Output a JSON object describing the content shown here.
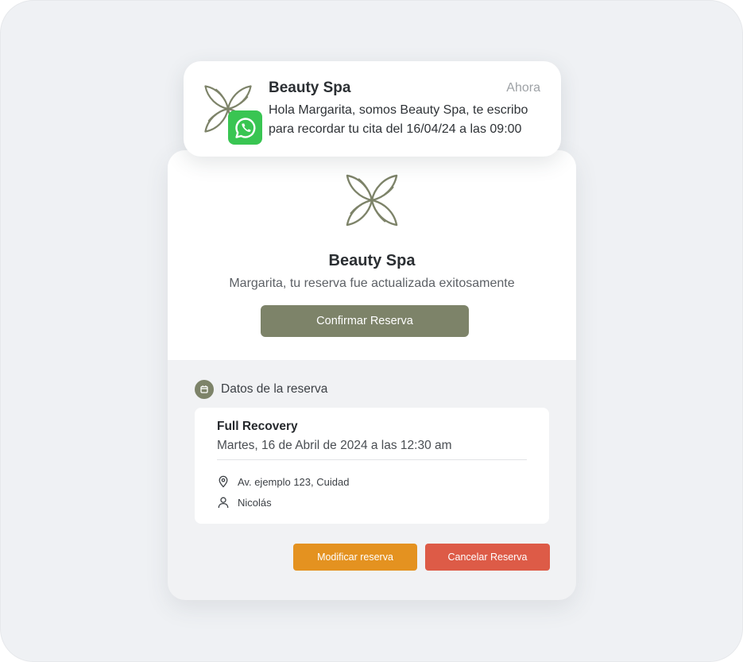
{
  "notification": {
    "title": "Beauty Spa",
    "time": "Ahora",
    "message": "Hola Margarita, somos Beauty Spa, te escribo para recordar tu cita del 16/04/24 a las 09:00",
    "app_icon": "whatsapp-icon"
  },
  "card": {
    "brand": "Beauty Spa",
    "subtitle": "Margarita, tu reserva fue actualizada exitosamente",
    "confirm_label": "Confirmar Reserva"
  },
  "reservation": {
    "section_title": "Datos de la reserva",
    "service": "Full Recovery",
    "datetime": "Martes, 16 de Abril de 2024 a las 12:30 am",
    "address": "Av. ejemplo 123, Cuidad",
    "staff": "Nicolás"
  },
  "actions": {
    "modify_label": "Modificar reserva",
    "cancel_label": "Cancelar Reserva"
  },
  "colors": {
    "brand_olive": "#7d8369",
    "modify_orange": "#e49220",
    "cancel_red": "#dd5b47",
    "whatsapp_green": "#39c552",
    "background": "#eff1f4"
  }
}
